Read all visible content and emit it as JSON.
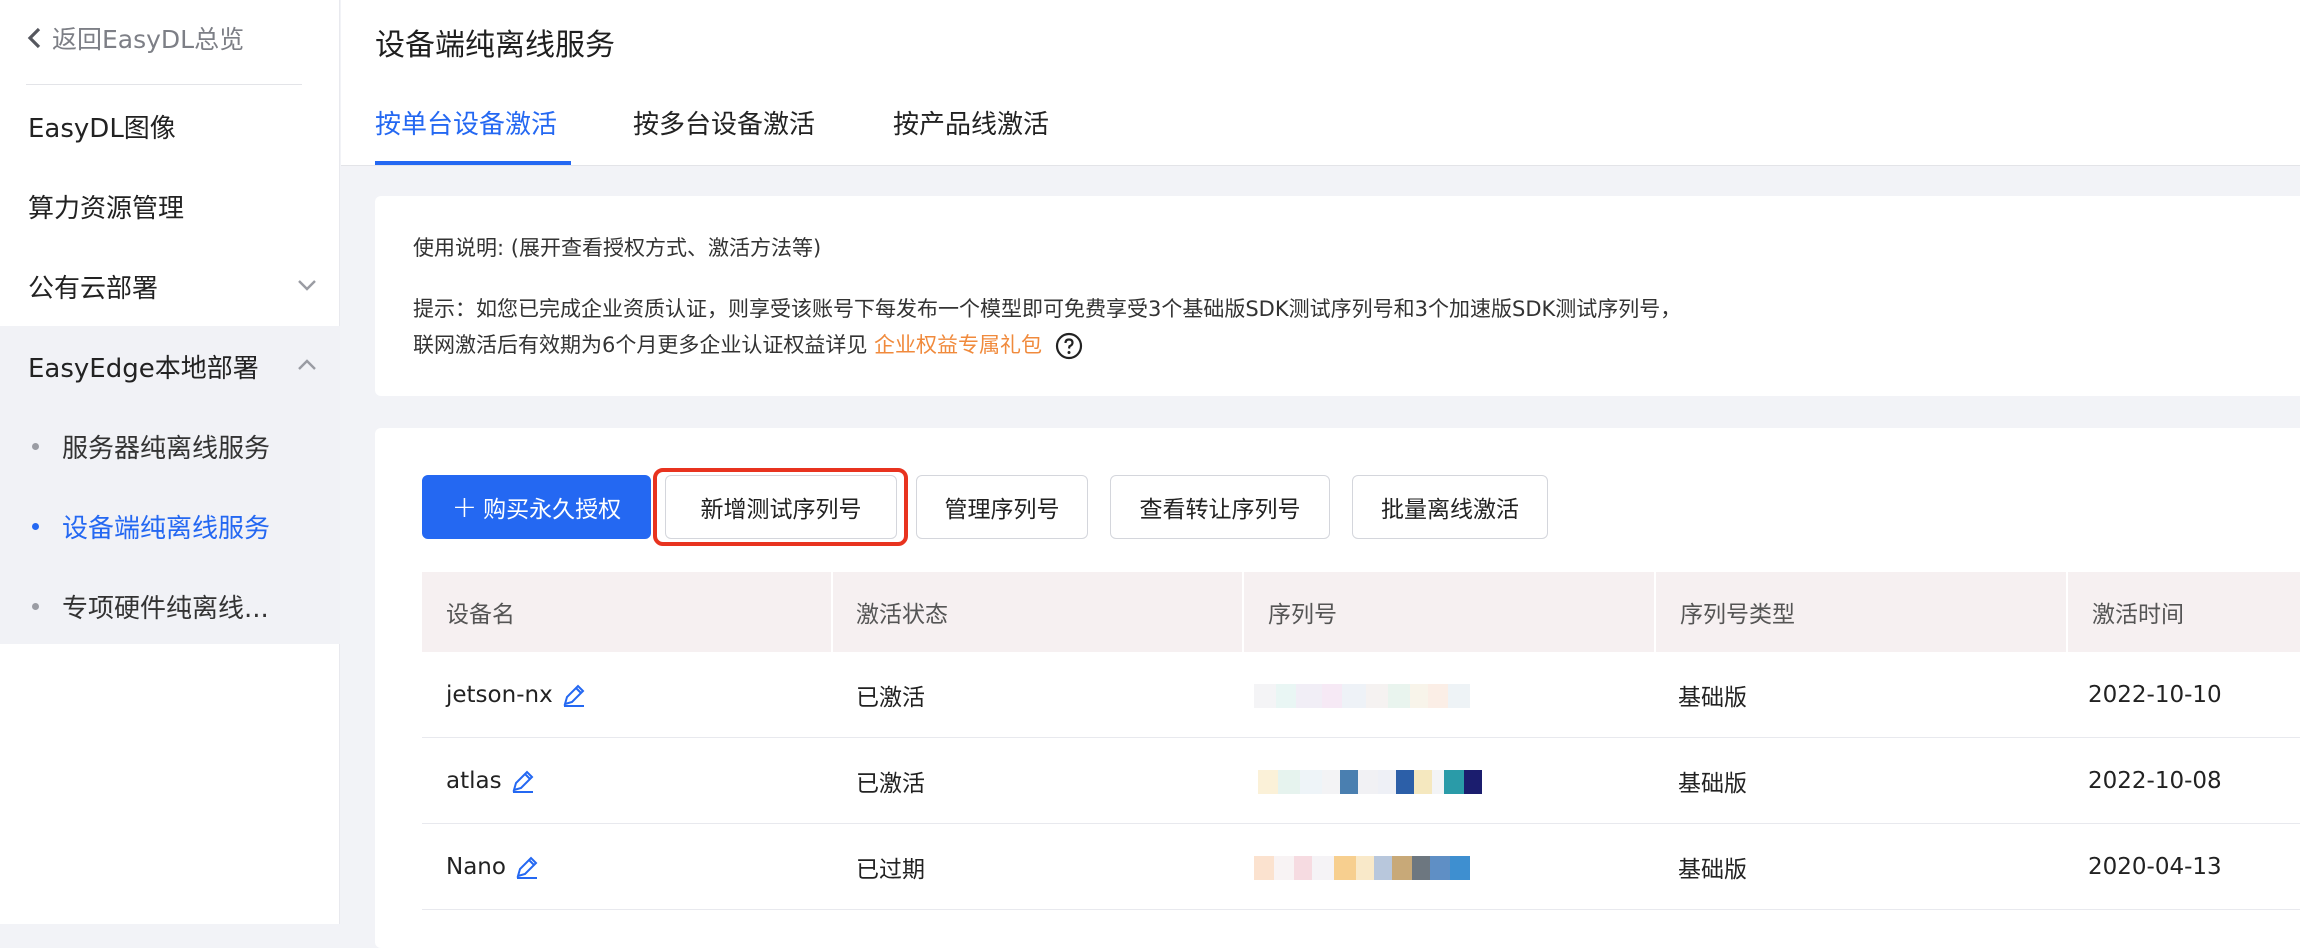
{
  "sidebar": {
    "back_label": "返回EasyDL总览",
    "items": [
      {
        "label": "EasyDL图像"
      },
      {
        "label": "算力资源管理"
      },
      {
        "label": "公有云部署"
      },
      {
        "label": "EasyEdge本地部署"
      }
    ],
    "sub_items": [
      {
        "label": "服务器纯离线服务"
      },
      {
        "label": "设备端纯离线服务"
      },
      {
        "label": "专项硬件纯离线..."
      }
    ]
  },
  "header": {
    "title": "设备端纯离线服务",
    "tabs": [
      {
        "label": "按单台设备激活"
      },
      {
        "label": "按多台设备激活"
      },
      {
        "label": "按产品线激活"
      }
    ]
  },
  "info": {
    "usage": "使用说明: (展开查看授权方式、激活方法等)",
    "tip_line1": "提示：如您已完成企业资质认证，则享受该账号下每发布一个模型即可免费享受3个基础版SDK测试序列号和3个加速版SDK测试序列号，",
    "tip_line2": "联网激活后有效期为6个月更多企业认证权益详见",
    "link": "企业权益专属礼包"
  },
  "toolbar": {
    "buy_label": "购买永久授权",
    "add_test_label": "新增测试序列号",
    "manage_label": "管理序列号",
    "transfer_label": "查看转让序列号",
    "batch_label": "批量离线激活"
  },
  "table": {
    "headers": [
      "设备名",
      "激活状态",
      "序列号",
      "序列号类型",
      "激活时间"
    ],
    "rows": [
      {
        "device": "jetson-nx",
        "status": "已激活",
        "type": "基础版",
        "time": "2022-10-10"
      },
      {
        "device": "atlas",
        "status": "已激活",
        "type": "基础版",
        "time": "2022-10-08"
      },
      {
        "device": "Nano",
        "status": "已过期",
        "type": "基础版",
        "time": "2020-04-13"
      }
    ]
  },
  "colors": {
    "accent": "#2468f2",
    "link": "#f08a3c",
    "highlight": "#e8331f"
  }
}
